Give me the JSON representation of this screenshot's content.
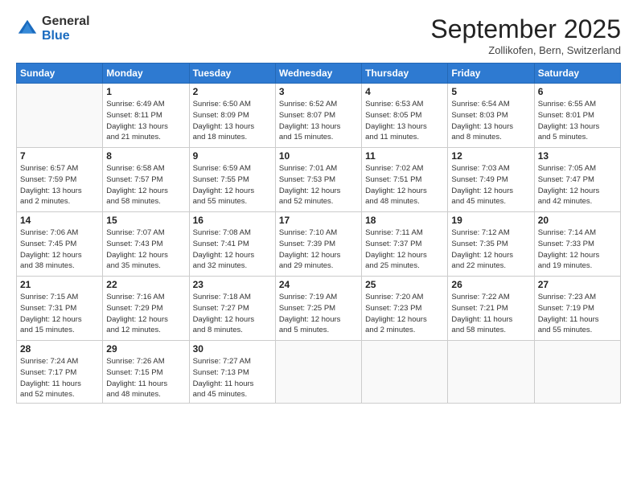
{
  "header": {
    "logo_general": "General",
    "logo_blue": "Blue",
    "month_title": "September 2025",
    "location": "Zollikofen, Bern, Switzerland"
  },
  "weekdays": [
    "Sunday",
    "Monday",
    "Tuesday",
    "Wednesday",
    "Thursday",
    "Friday",
    "Saturday"
  ],
  "weeks": [
    [
      {
        "day": "",
        "info": ""
      },
      {
        "day": "1",
        "info": "Sunrise: 6:49 AM\nSunset: 8:11 PM\nDaylight: 13 hours\nand 21 minutes."
      },
      {
        "day": "2",
        "info": "Sunrise: 6:50 AM\nSunset: 8:09 PM\nDaylight: 13 hours\nand 18 minutes."
      },
      {
        "day": "3",
        "info": "Sunrise: 6:52 AM\nSunset: 8:07 PM\nDaylight: 13 hours\nand 15 minutes."
      },
      {
        "day": "4",
        "info": "Sunrise: 6:53 AM\nSunset: 8:05 PM\nDaylight: 13 hours\nand 11 minutes."
      },
      {
        "day": "5",
        "info": "Sunrise: 6:54 AM\nSunset: 8:03 PM\nDaylight: 13 hours\nand 8 minutes."
      },
      {
        "day": "6",
        "info": "Sunrise: 6:55 AM\nSunset: 8:01 PM\nDaylight: 13 hours\nand 5 minutes."
      }
    ],
    [
      {
        "day": "7",
        "info": "Sunrise: 6:57 AM\nSunset: 7:59 PM\nDaylight: 13 hours\nand 2 minutes."
      },
      {
        "day": "8",
        "info": "Sunrise: 6:58 AM\nSunset: 7:57 PM\nDaylight: 12 hours\nand 58 minutes."
      },
      {
        "day": "9",
        "info": "Sunrise: 6:59 AM\nSunset: 7:55 PM\nDaylight: 12 hours\nand 55 minutes."
      },
      {
        "day": "10",
        "info": "Sunrise: 7:01 AM\nSunset: 7:53 PM\nDaylight: 12 hours\nand 52 minutes."
      },
      {
        "day": "11",
        "info": "Sunrise: 7:02 AM\nSunset: 7:51 PM\nDaylight: 12 hours\nand 48 minutes."
      },
      {
        "day": "12",
        "info": "Sunrise: 7:03 AM\nSunset: 7:49 PM\nDaylight: 12 hours\nand 45 minutes."
      },
      {
        "day": "13",
        "info": "Sunrise: 7:05 AM\nSunset: 7:47 PM\nDaylight: 12 hours\nand 42 minutes."
      }
    ],
    [
      {
        "day": "14",
        "info": "Sunrise: 7:06 AM\nSunset: 7:45 PM\nDaylight: 12 hours\nand 38 minutes."
      },
      {
        "day": "15",
        "info": "Sunrise: 7:07 AM\nSunset: 7:43 PM\nDaylight: 12 hours\nand 35 minutes."
      },
      {
        "day": "16",
        "info": "Sunrise: 7:08 AM\nSunset: 7:41 PM\nDaylight: 12 hours\nand 32 minutes."
      },
      {
        "day": "17",
        "info": "Sunrise: 7:10 AM\nSunset: 7:39 PM\nDaylight: 12 hours\nand 29 minutes."
      },
      {
        "day": "18",
        "info": "Sunrise: 7:11 AM\nSunset: 7:37 PM\nDaylight: 12 hours\nand 25 minutes."
      },
      {
        "day": "19",
        "info": "Sunrise: 7:12 AM\nSunset: 7:35 PM\nDaylight: 12 hours\nand 22 minutes."
      },
      {
        "day": "20",
        "info": "Sunrise: 7:14 AM\nSunset: 7:33 PM\nDaylight: 12 hours\nand 19 minutes."
      }
    ],
    [
      {
        "day": "21",
        "info": "Sunrise: 7:15 AM\nSunset: 7:31 PM\nDaylight: 12 hours\nand 15 minutes."
      },
      {
        "day": "22",
        "info": "Sunrise: 7:16 AM\nSunset: 7:29 PM\nDaylight: 12 hours\nand 12 minutes."
      },
      {
        "day": "23",
        "info": "Sunrise: 7:18 AM\nSunset: 7:27 PM\nDaylight: 12 hours\nand 8 minutes."
      },
      {
        "day": "24",
        "info": "Sunrise: 7:19 AM\nSunset: 7:25 PM\nDaylight: 12 hours\nand 5 minutes."
      },
      {
        "day": "25",
        "info": "Sunrise: 7:20 AM\nSunset: 7:23 PM\nDaylight: 12 hours\nand 2 minutes."
      },
      {
        "day": "26",
        "info": "Sunrise: 7:22 AM\nSunset: 7:21 PM\nDaylight: 11 hours\nand 58 minutes."
      },
      {
        "day": "27",
        "info": "Sunrise: 7:23 AM\nSunset: 7:19 PM\nDaylight: 11 hours\nand 55 minutes."
      }
    ],
    [
      {
        "day": "28",
        "info": "Sunrise: 7:24 AM\nSunset: 7:17 PM\nDaylight: 11 hours\nand 52 minutes."
      },
      {
        "day": "29",
        "info": "Sunrise: 7:26 AM\nSunset: 7:15 PM\nDaylight: 11 hours\nand 48 minutes."
      },
      {
        "day": "30",
        "info": "Sunrise: 7:27 AM\nSunset: 7:13 PM\nDaylight: 11 hours\nand 45 minutes."
      },
      {
        "day": "",
        "info": ""
      },
      {
        "day": "",
        "info": ""
      },
      {
        "day": "",
        "info": ""
      },
      {
        "day": "",
        "info": ""
      }
    ]
  ]
}
